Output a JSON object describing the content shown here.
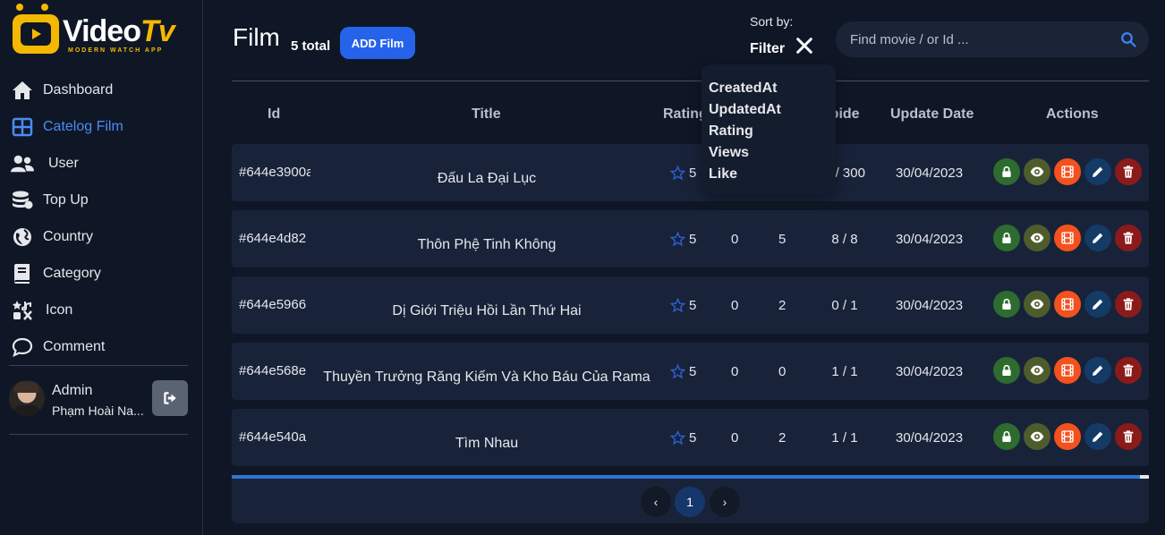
{
  "brand": {
    "name_main": "Video",
    "name_accent": "Tv",
    "tagline": "MODERN WATCH APP"
  },
  "sidebar": {
    "items": [
      {
        "label": "Dashboard",
        "icon": "home-icon"
      },
      {
        "label": "Catelog Film",
        "icon": "grid-icon",
        "active": true
      },
      {
        "label": "User",
        "icon": "users-icon"
      },
      {
        "label": "Top Up",
        "icon": "coins-icon"
      },
      {
        "label": "Country",
        "icon": "globe-icon"
      },
      {
        "label": "Category",
        "icon": "book-icon"
      },
      {
        "label": "Icon",
        "icon": "icons-icon"
      },
      {
        "label": "Comment",
        "icon": "comment-icon"
      }
    ],
    "user": {
      "role": "Admin",
      "name": "Phạm Hoài Na..."
    }
  },
  "header": {
    "title": "Film",
    "total": "5 total",
    "add_label": "ADD Film",
    "sort_label": "Sort by:",
    "filter_label": "Filter",
    "search_placeholder": "Find movie / or Id ..."
  },
  "sort_options": [
    "CreatedAt",
    "UpdatedAt",
    "Rating",
    "Views",
    "Like"
  ],
  "table": {
    "columns": {
      "id": "Id",
      "title": "Title",
      "rating": "Rating",
      "episode": "Epide",
      "update_date": "Update Date",
      "actions": "Actions"
    },
    "rows": [
      {
        "id": "#644e3900a",
        "title": "Đấu La Đại Lục",
        "rating": "5",
        "likes": "",
        "views": "",
        "episode": "7 / 300",
        "date": "30/04/2023"
      },
      {
        "id": "#644e4d82",
        "title": "Thôn Phệ Tinh Không",
        "rating": "5",
        "likes": "0",
        "views": "5",
        "episode": "8 / 8",
        "date": "30/04/2023"
      },
      {
        "id": "#644e5966",
        "title": "Dị Giới Triệu Hồi Lần Thứ Hai",
        "rating": "5",
        "likes": "0",
        "views": "2",
        "episode": "0 / 1",
        "date": "30/04/2023"
      },
      {
        "id": "#644e568e",
        "title": "Thuyền Trưởng Răng Kiếm Và Kho Báu Của Rama",
        "rating": "5",
        "likes": "0",
        "views": "0",
        "episode": "1 / 1",
        "date": "30/04/2023"
      },
      {
        "id": "#644e540a",
        "title": "Tìm Nhau",
        "rating": "5",
        "likes": "0",
        "views": "2",
        "episode": "1 / 1",
        "date": "30/04/2023"
      }
    ]
  },
  "pagination": {
    "prev": "‹",
    "current": "1",
    "next": "›"
  },
  "scroll_progress": 0.99,
  "colors": {
    "accent": "#2563eb",
    "brand": "#f5b800",
    "active_nav": "#4b8bf5",
    "background": "#0f1726",
    "row": "#18233a"
  }
}
